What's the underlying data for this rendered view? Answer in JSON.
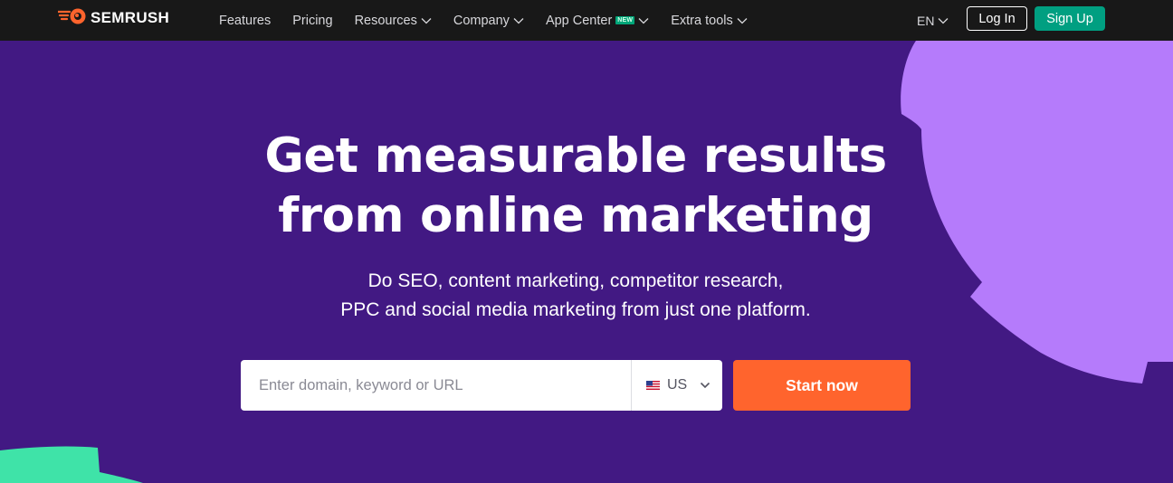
{
  "brand": {
    "name": "SEMRUSH",
    "accent": "#ff642d",
    "green": "#009f81"
  },
  "nav": {
    "items": [
      {
        "label": "Features",
        "has_dropdown": false
      },
      {
        "label": "Pricing",
        "has_dropdown": false
      },
      {
        "label": "Resources",
        "has_dropdown": true
      },
      {
        "label": "Company",
        "has_dropdown": true
      },
      {
        "label": "App Center",
        "has_dropdown": true,
        "badge": "NEW"
      },
      {
        "label": "Extra tools",
        "has_dropdown": true
      }
    ],
    "language": "EN",
    "login_label": "Log In",
    "signup_label": "Sign Up"
  },
  "hero": {
    "title_line1": "Get measurable results",
    "title_line2": "from online marketing",
    "subtitle_line1": "Do SEO, content marketing, competitor research,",
    "subtitle_line2": "PPC and social media marketing from just one platform."
  },
  "search": {
    "placeholder": "Enter domain, keyword or URL",
    "value": "",
    "database": "US",
    "database_icon": "us-flag-icon",
    "submit_label": "Start now"
  },
  "colors": {
    "background": "#421983",
    "topbar": "#181818",
    "lavender_shape": "#b57bfb",
    "mint_shape": "#3fe3a8"
  }
}
